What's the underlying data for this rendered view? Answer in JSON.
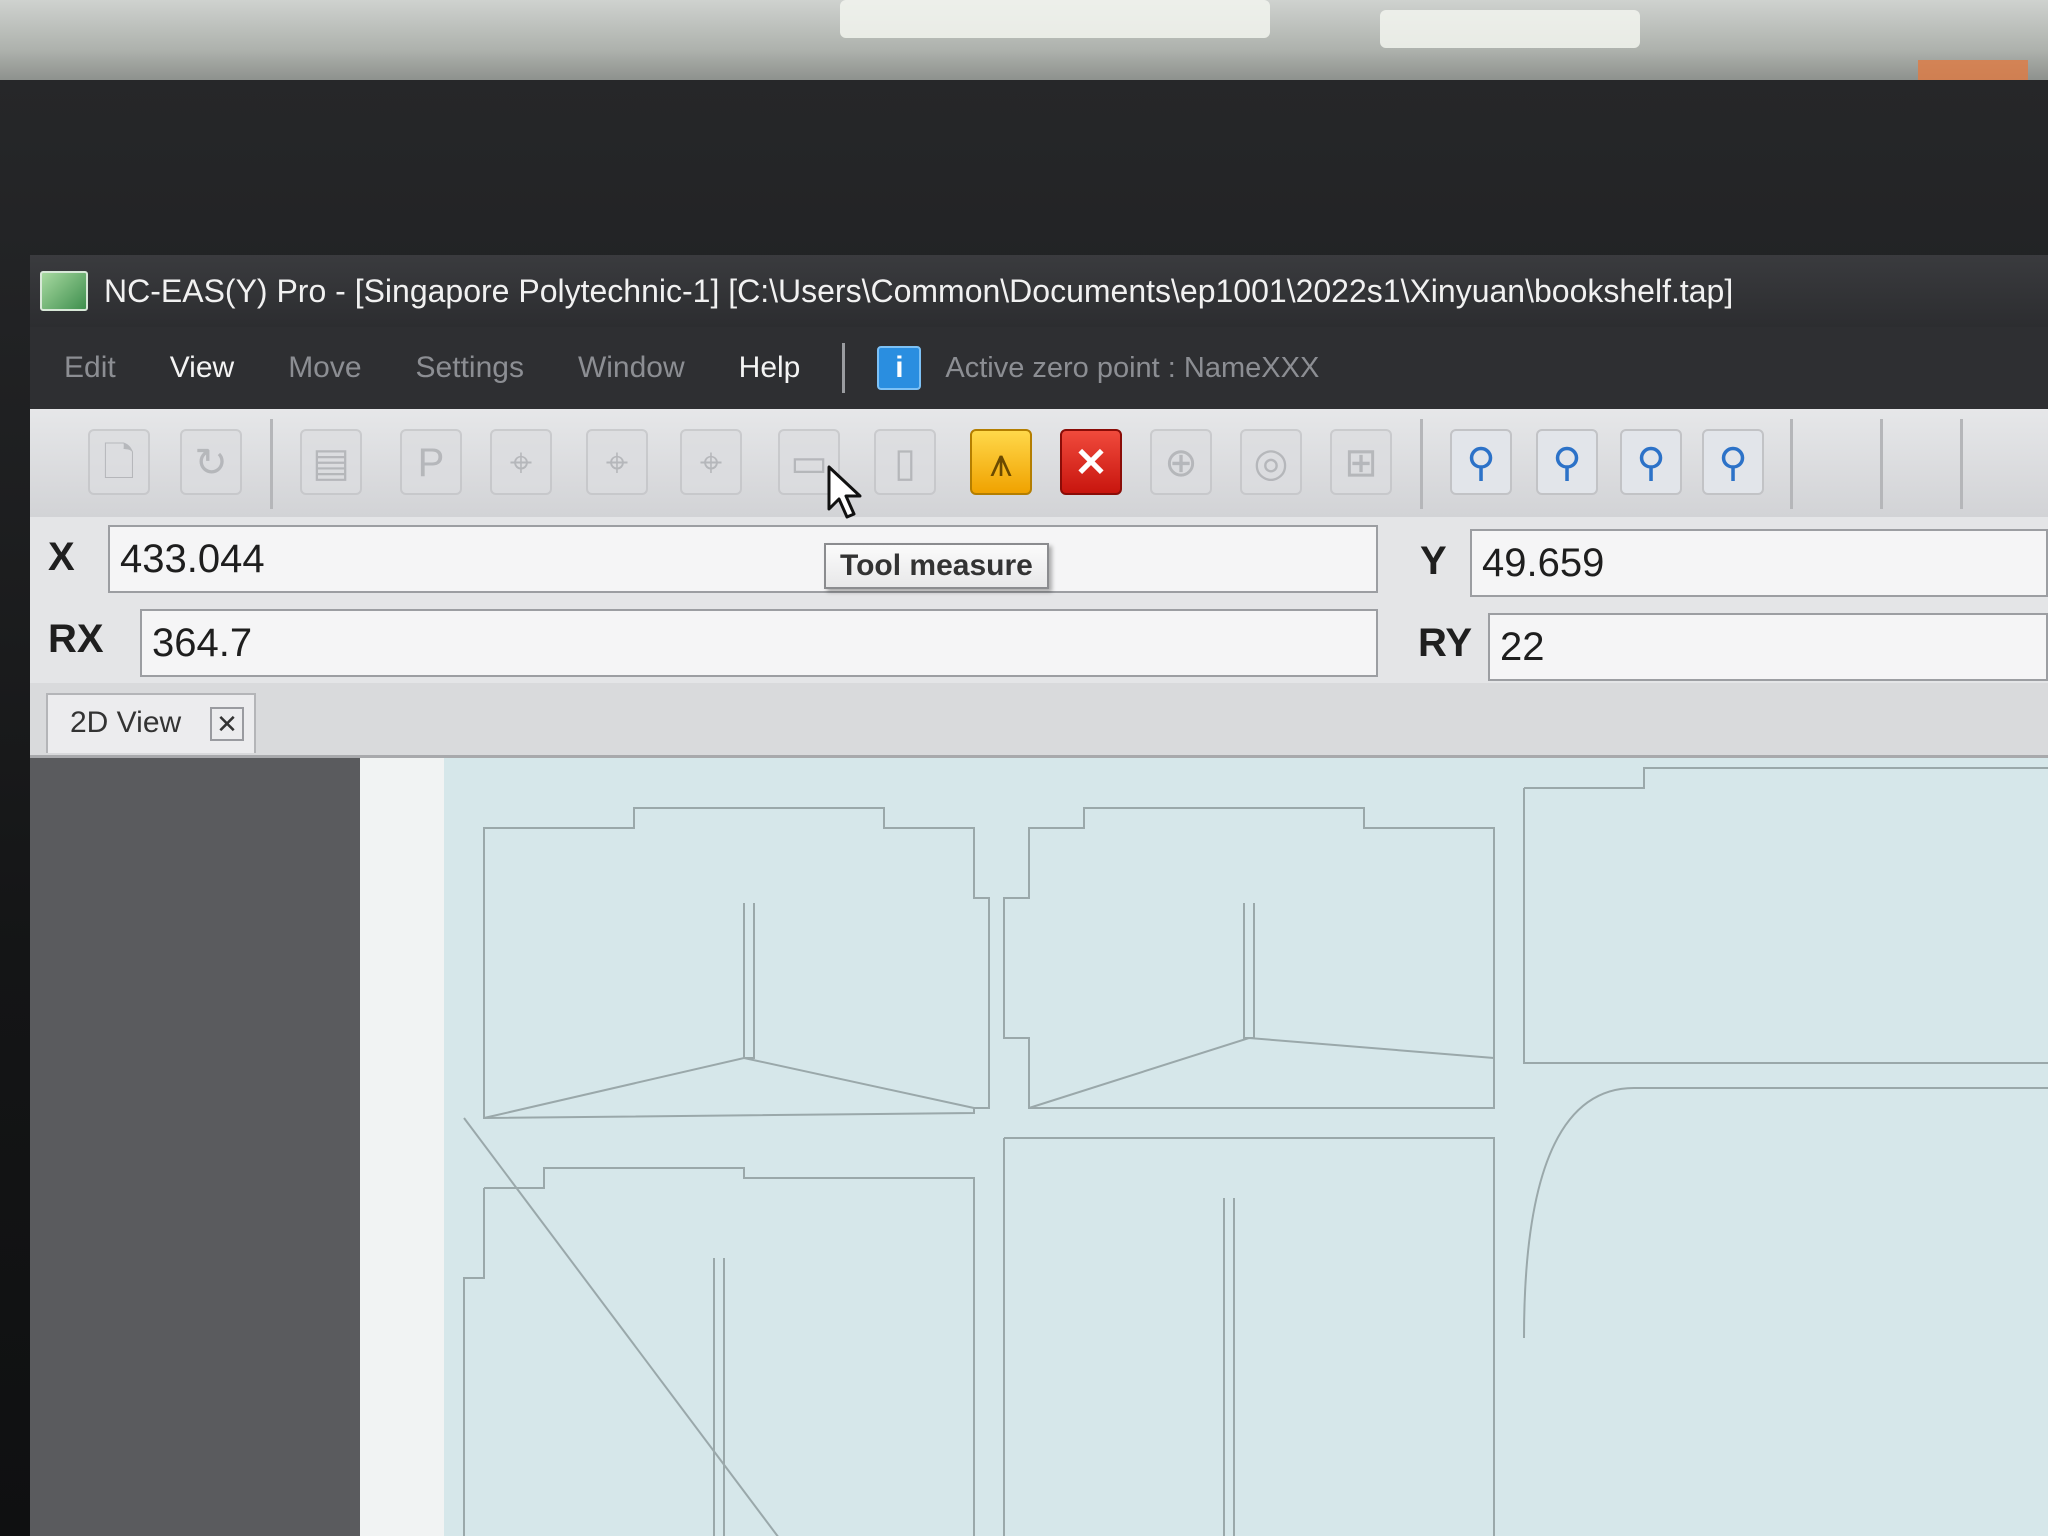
{
  "window": {
    "title": "NC-EAS(Y) Pro - [Singapore Polytechnic-1] [C:\\Users\\Common\\Documents\\ep1001\\2022s1\\Xinyuan\\bookshelf.tap]"
  },
  "menu": {
    "items": [
      {
        "label": "Edit",
        "enabled": false
      },
      {
        "label": "View",
        "enabled": true
      },
      {
        "label": "Move",
        "enabled": false
      },
      {
        "label": "Settings",
        "enabled": false
      },
      {
        "label": "Window",
        "enabled": false
      },
      {
        "label": "Help",
        "enabled": true
      }
    ],
    "active_zero_point": "Active zero point : NameXXX"
  },
  "toolbar": {
    "buttons": [
      {
        "icon": "new-file-icon",
        "glyph": "🗋"
      },
      {
        "icon": "open-file-icon",
        "glyph": "↻"
      },
      {
        "icon": "program-icon",
        "glyph": "▤"
      },
      {
        "icon": "parameter-icon",
        "glyph": "P"
      },
      {
        "icon": "reference-x-icon",
        "glyph": "⌖"
      },
      {
        "icon": "reference-y-icon",
        "glyph": "⌖"
      },
      {
        "icon": "reference-z-icon",
        "glyph": "⌖"
      },
      {
        "icon": "tool-measure-icon",
        "glyph": "▭"
      },
      {
        "icon": "page-icon",
        "glyph": "▯"
      },
      {
        "icon": "start-icon",
        "glyph": "⩚"
      },
      {
        "icon": "stop-icon",
        "glyph": "✕"
      },
      {
        "icon": "jog-icon",
        "glyph": "⊕"
      },
      {
        "icon": "spindle-icon",
        "glyph": "◎"
      },
      {
        "icon": "pallet-icon",
        "glyph": "⊞"
      },
      {
        "icon": "zoom-fit-icon",
        "glyph": "⚲"
      },
      {
        "icon": "zoom-window-icon",
        "glyph": "⚲"
      },
      {
        "icon": "zoom-in-icon",
        "glyph": "⚲"
      },
      {
        "icon": "zoom-select-icon",
        "glyph": "⚲"
      }
    ],
    "tooltip": "Tool measure"
  },
  "coordinates": {
    "x_label": "X",
    "x_value": "433.044",
    "y_label": "Y",
    "y_value": "49.659",
    "rx_label": "RX",
    "rx_value": "364.7",
    "ry_label": "RY",
    "ry_value": "22"
  },
  "tabs": [
    {
      "label": "2D View",
      "close_glyph": "✕"
    }
  ],
  "colors": {
    "menubar": "#2e2f32",
    "canvas": "#d6e7ea",
    "stop_red": "#d8281e",
    "start_yellow": "#f5b800",
    "info_blue": "#2a8ee0"
  }
}
